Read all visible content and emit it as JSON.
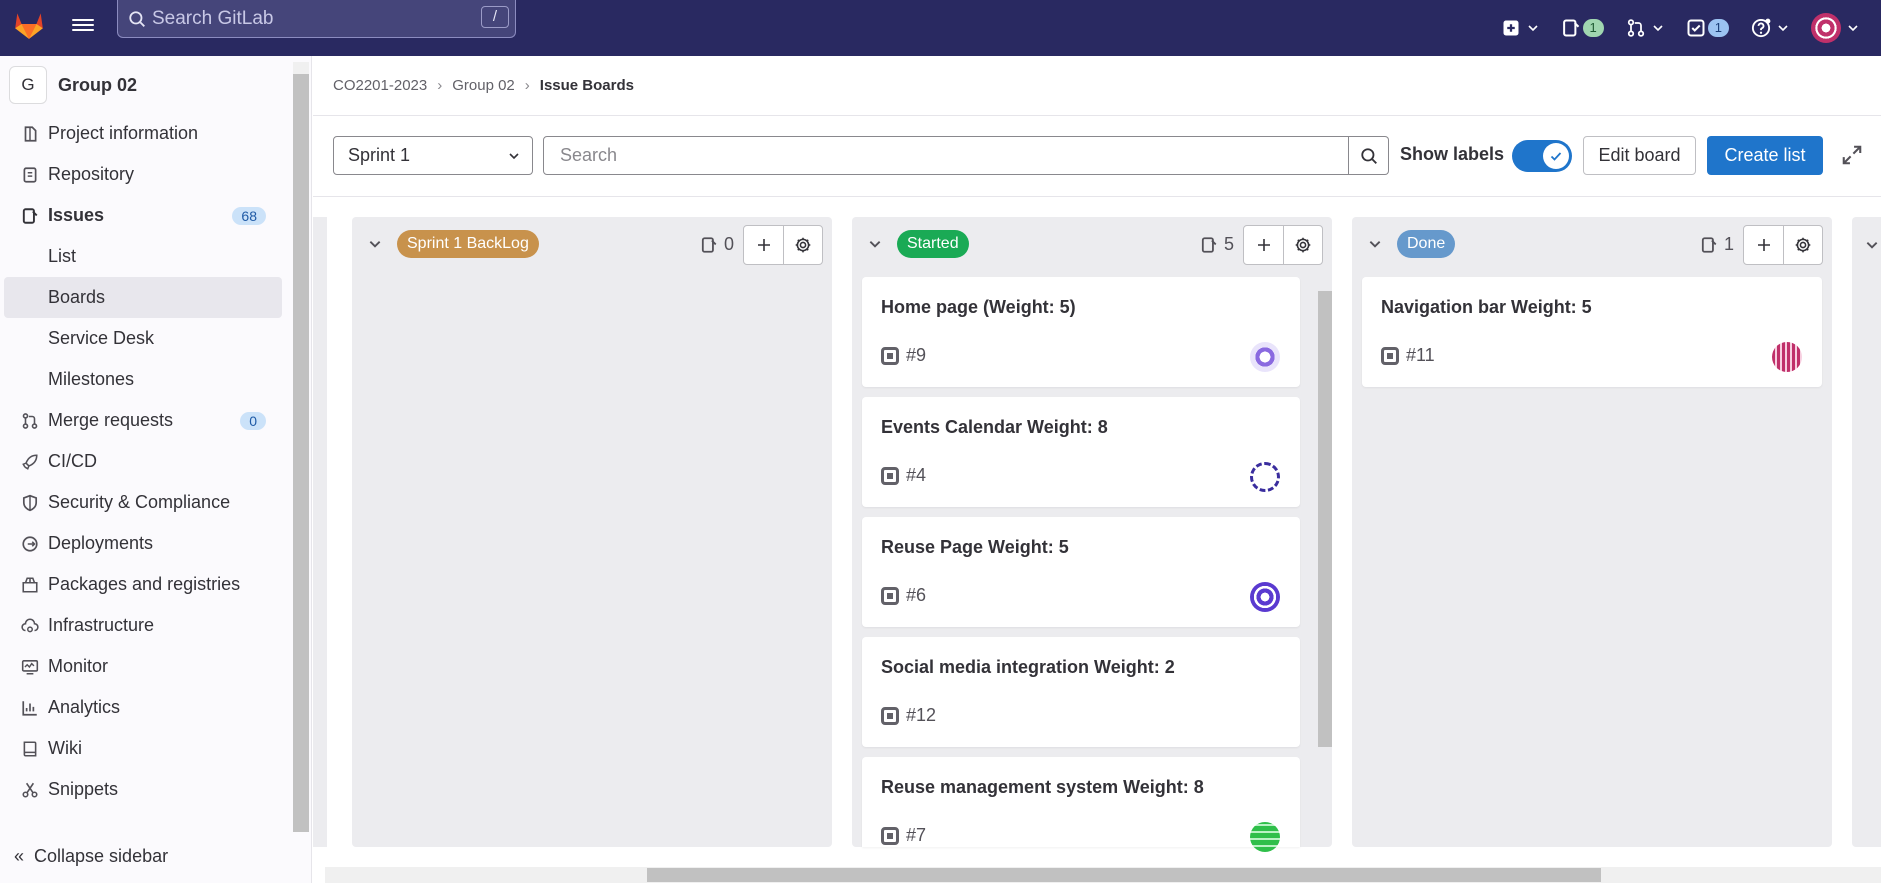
{
  "topbar": {
    "search_placeholder": "Search GitLab",
    "search_shortcut": "/",
    "issues_badge": "1",
    "todos_badge": "1"
  },
  "sidebar": {
    "project_initial": "G",
    "project_name": "Group 02",
    "items": [
      {
        "label": "Project information"
      },
      {
        "label": "Repository"
      },
      {
        "label": "Issues",
        "count": "68"
      },
      {
        "label": "List"
      },
      {
        "label": "Boards"
      },
      {
        "label": "Service Desk"
      },
      {
        "label": "Milestones"
      },
      {
        "label": "Merge requests",
        "count": "0"
      },
      {
        "label": "CI/CD"
      },
      {
        "label": "Security & Compliance"
      },
      {
        "label": "Deployments"
      },
      {
        "label": "Packages and registries"
      },
      {
        "label": "Infrastructure"
      },
      {
        "label": "Monitor"
      },
      {
        "label": "Analytics"
      },
      {
        "label": "Wiki"
      },
      {
        "label": "Snippets"
      }
    ],
    "collapse_label": "Collapse sidebar"
  },
  "breadcrumb": {
    "items": [
      "CO2201-2023",
      "Group 02",
      "Issue Boards"
    ]
  },
  "toolbar": {
    "sprint_value": "Sprint 1",
    "search_placeholder": "Search",
    "show_labels": "Show labels",
    "edit_board": "Edit board",
    "create_list": "Create list"
  },
  "lists": [
    {
      "label": "Sprint 1 BackLog",
      "color": "#c8924c",
      "count": "0",
      "cards": []
    },
    {
      "label": "Started",
      "color": "#1aaa55",
      "count": "5",
      "cards": [
        {
          "title": "Home page (Weight: 5)",
          "number": "#9"
        },
        {
          "title": "Events Calendar Weight: 8",
          "number": "#4"
        },
        {
          "title": "Reuse Page Weight: 5",
          "number": "#6"
        },
        {
          "title": "Social media integration Weight: 2",
          "number": "#12"
        },
        {
          "title": "Reuse management system Weight: 8",
          "number": "#7"
        }
      ]
    },
    {
      "label": "Done",
      "color": "#6699cc",
      "count": "1",
      "cards": [
        {
          "title": "Navigation bar Weight: 5",
          "number": "#11"
        }
      ]
    }
  ]
}
